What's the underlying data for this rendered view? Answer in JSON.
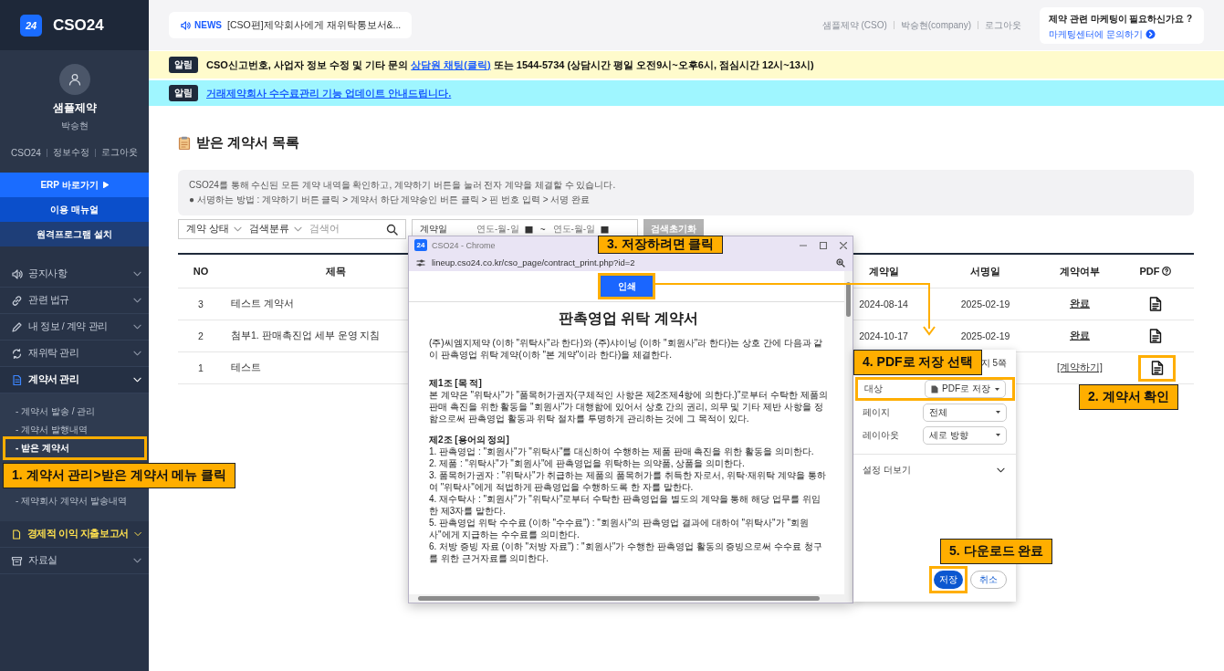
{
  "sidebar": {
    "logo_badge": "24",
    "logo_text": "CSO24",
    "company": "샘플제약",
    "user": "박승현",
    "links": [
      "CSO24",
      "정보수정",
      "로그아웃"
    ],
    "quick_buttons": [
      {
        "label": "ERP 바로가기",
        "kind": "primary"
      },
      {
        "label": "이용 매뉴얼",
        "kind": "secondary"
      },
      {
        "label": "원격프로그램 설치",
        "kind": "tertiary"
      }
    ],
    "menu": [
      {
        "label": "공지사항",
        "selected": false,
        "highlight": false
      },
      {
        "label": "관련 법규",
        "selected": false,
        "highlight": false
      },
      {
        "label": "내 정보 / 계약 관리",
        "selected": false,
        "highlight": false
      },
      {
        "label": "재위탁 관리",
        "selected": false,
        "highlight": false
      },
      {
        "label": "계약서 관리",
        "selected": true,
        "highlight": false,
        "children": [
          {
            "label": "- 계약서 발송 / 관리",
            "selected": false
          },
          {
            "label": "- 계약서 발행내역",
            "selected": false
          },
          {
            "label": "- 받은 계약서",
            "selected": true
          },
          {
            "label": "- 제약회사 계약서 발송내역",
            "selected": false
          }
        ]
      },
      {
        "label": "경제적 이익 지출보고서",
        "selected": false,
        "highlight": true
      },
      {
        "label": "자료실",
        "selected": false,
        "highlight": false
      }
    ]
  },
  "header": {
    "news": {
      "label": "NEWS",
      "text": "[CSO편]제약회사에게 재위탁통보서&..."
    },
    "user_links": [
      "샘플제약 (CSO)",
      "박승현(company)",
      "로그아웃"
    ],
    "promo": {
      "title": "제약 관련 마케팅이 필요하신가요 ?",
      "link": "마케팅센터에 문의하기"
    }
  },
  "notices": [
    {
      "kind": "info",
      "badge": "알림",
      "text": "CSO신고번호, 사업자 정보 수정 및 기타 문의 ",
      "link": "상담원 채팅(클릭)",
      "after": " 또는 1544-5734 (상담시간 평일 오전9시~오후6시, 점심시간 12시~13시)"
    },
    {
      "kind": "update",
      "badge": "알림",
      "link": "거래제약회사 수수료관리 기능 업데이트 안내드립니다."
    }
  ],
  "page": {
    "title": "받은 계약서 목록",
    "description": [
      "CSO24를 통해 수신된 모든 계약 내역을 확인하고, 계약하기 버튼을 눌러 전자 계약을 체결할 수 있습니다.",
      "● 서명하는 방법 : 계약하기 버튼 클릭 > 계약서 하단 계약승인 버튼 클릭 > 핀 번호 입력 > 서명 완료"
    ],
    "filters": {
      "status_select": "계약 상태",
      "category_select": "검색분류",
      "search_placeholder": "검색어",
      "date_label": "계약일",
      "date_from_placeholder": "연도-월-일",
      "date_separator": "~",
      "date_to_placeholder": "연도-월-일",
      "reset_button": "검색초기화"
    },
    "table": {
      "columns": [
        "NO",
        "제목",
        "계약일",
        "서명일",
        "계약여부",
        "PDF"
      ],
      "rows": [
        {
          "no": "3",
          "title": "테스트 계약서",
          "contract_date": "2024-08-14",
          "sign_date": "2025-02-19",
          "status": "완료",
          "confirmed": true
        },
        {
          "no": "2",
          "title": "첨부1. 판매촉진업 세부 운영 지침",
          "contract_date": "2024-10-17",
          "sign_date": "2025-02-19",
          "status": "완료",
          "confirmed": true
        },
        {
          "no": "1",
          "title": "테스트",
          "status": "[계약하기]",
          "confirmed": false
        }
      ]
    }
  },
  "popup": {
    "app_badge": "24",
    "title": "CSO24 - Chrome",
    "url": "lineup.cso24.co.kr/cso_page/contract_print.php?id=2",
    "print_button": "인쇄",
    "document": {
      "title": "판촉영업 위탁 계약서",
      "blocks": [
        {
          "kind": "paragraph",
          "text": "(주)씨엠지제약 (이하 \"위탁사\"라 한다)와 (주)샤이닝 (이하 \"회원사\"라 한다)는 상호 간에 다음과 같이 판촉영업 위탁 계약(이하 \"본 계약\"이라 한다)을 체결한다."
        },
        {
          "kind": "heading",
          "text": "제1조 [목 적]"
        },
        {
          "kind": "paragraph",
          "text": "본 계약은 \"위탁사\"가 \"품목허가권자(구체적인 사항은 제2조제4항에 의한다.)\"로부터 수탁한 제품의 판매 촉진을 위한 활동을 \"회원사\"가 대행함에 있어서 상호 간의 권리, 의무 및 기타 제반 사항을 정함으로써 판촉영업 활동과 위탁 절차를 투명하게 관리하는 것에 그 목적이 있다."
        },
        {
          "kind": "heading",
          "text": "제2조 [용어의 정의]"
        },
        {
          "kind": "item",
          "text": "1. 판촉영업 : \"회원사\"가 \"위탁사\"를 대신하여 수행하는 제품 판매 촉진을 위한 활동을 의미한다."
        },
        {
          "kind": "item",
          "text": "2. 제품 : \"위탁사\"가 \"회원사\"에 판촉영업을 위탁하는 의약품, 상품을 의미한다."
        },
        {
          "kind": "item",
          "text": "3. 품목허가권자 : \"위탁사\"가 취급하는 제품의 품목허가를 취득한 자로서, 위탁·재위탁 계약을 통하여 \"위탁사\"에게 적법하게 판촉영업을 수행하도록 한 자를 말한다."
        },
        {
          "kind": "item",
          "text": "4. 재수탁사 : \"회원사\"가 \"위탁사\"로부터 수탁한 판촉영업을 별도의 계약을 통해 해당 업무를 위임한 제3자를 말한다."
        },
        {
          "kind": "item",
          "text": "5. 판촉영업 위탁 수수료 (이하 \"수수료\") : \"회원사\"의 판촉영업 결과에 대하여 \"위탁사\"가 \"회원사\"에게 지급하는 수수료를 의미한다."
        },
        {
          "kind": "item",
          "text": "6. 처방 증빙 자료 (이하 \"처방 자료\") : \"회원사\"가 수행한 판촉영업 활동의 증빙으로써 수수료 청구를 위한 근거자료를 의미한다."
        }
      ]
    }
  },
  "print_dialog": {
    "page_count": "지 5쪽",
    "fields": [
      {
        "label": "대상",
        "value": "PDF로 저장"
      },
      {
        "label": "페이지",
        "value": "전체"
      },
      {
        "label": "레이아웃",
        "value": "세로 방향"
      }
    ],
    "more_settings": "설정 더보기",
    "buttons": [
      {
        "label": "저장",
        "kind": "primary"
      },
      {
        "label": "취소",
        "kind": "secondary"
      }
    ]
  },
  "guide": [
    "1. 계약서 관리>받은 계약서 메뉴 클릭",
    "2. 계약서 확인",
    "3. 저장하려면 클릭",
    "4. PDF로 저장 선택",
    "5. 다운로드 완료"
  ]
}
